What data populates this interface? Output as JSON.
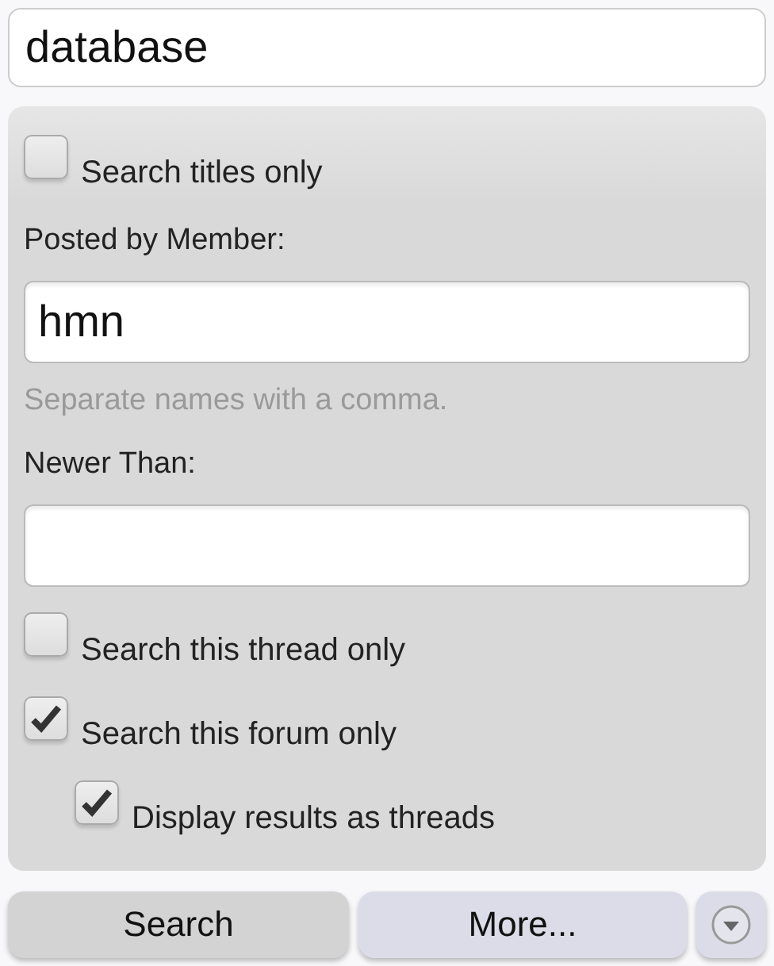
{
  "query": {
    "value": "database"
  },
  "titles_only": {
    "label": "Search titles only",
    "checked": false
  },
  "member": {
    "label": "Posted by Member:",
    "value": "hmn",
    "hint": "Separate names with a comma."
  },
  "newer_than": {
    "label": "Newer Than:"
  },
  "scope": [
    {
      "label": "Search this thread only",
      "checked": false
    },
    {
      "label": "Search this forum only",
      "checked": true,
      "children": [
        {
          "label": "Display results as threads",
          "checked": true
        }
      ]
    }
  ],
  "buttons": [
    {
      "label": "Search",
      "kind": "submit"
    },
    {
      "label": "More...",
      "kind": "more"
    }
  ]
}
